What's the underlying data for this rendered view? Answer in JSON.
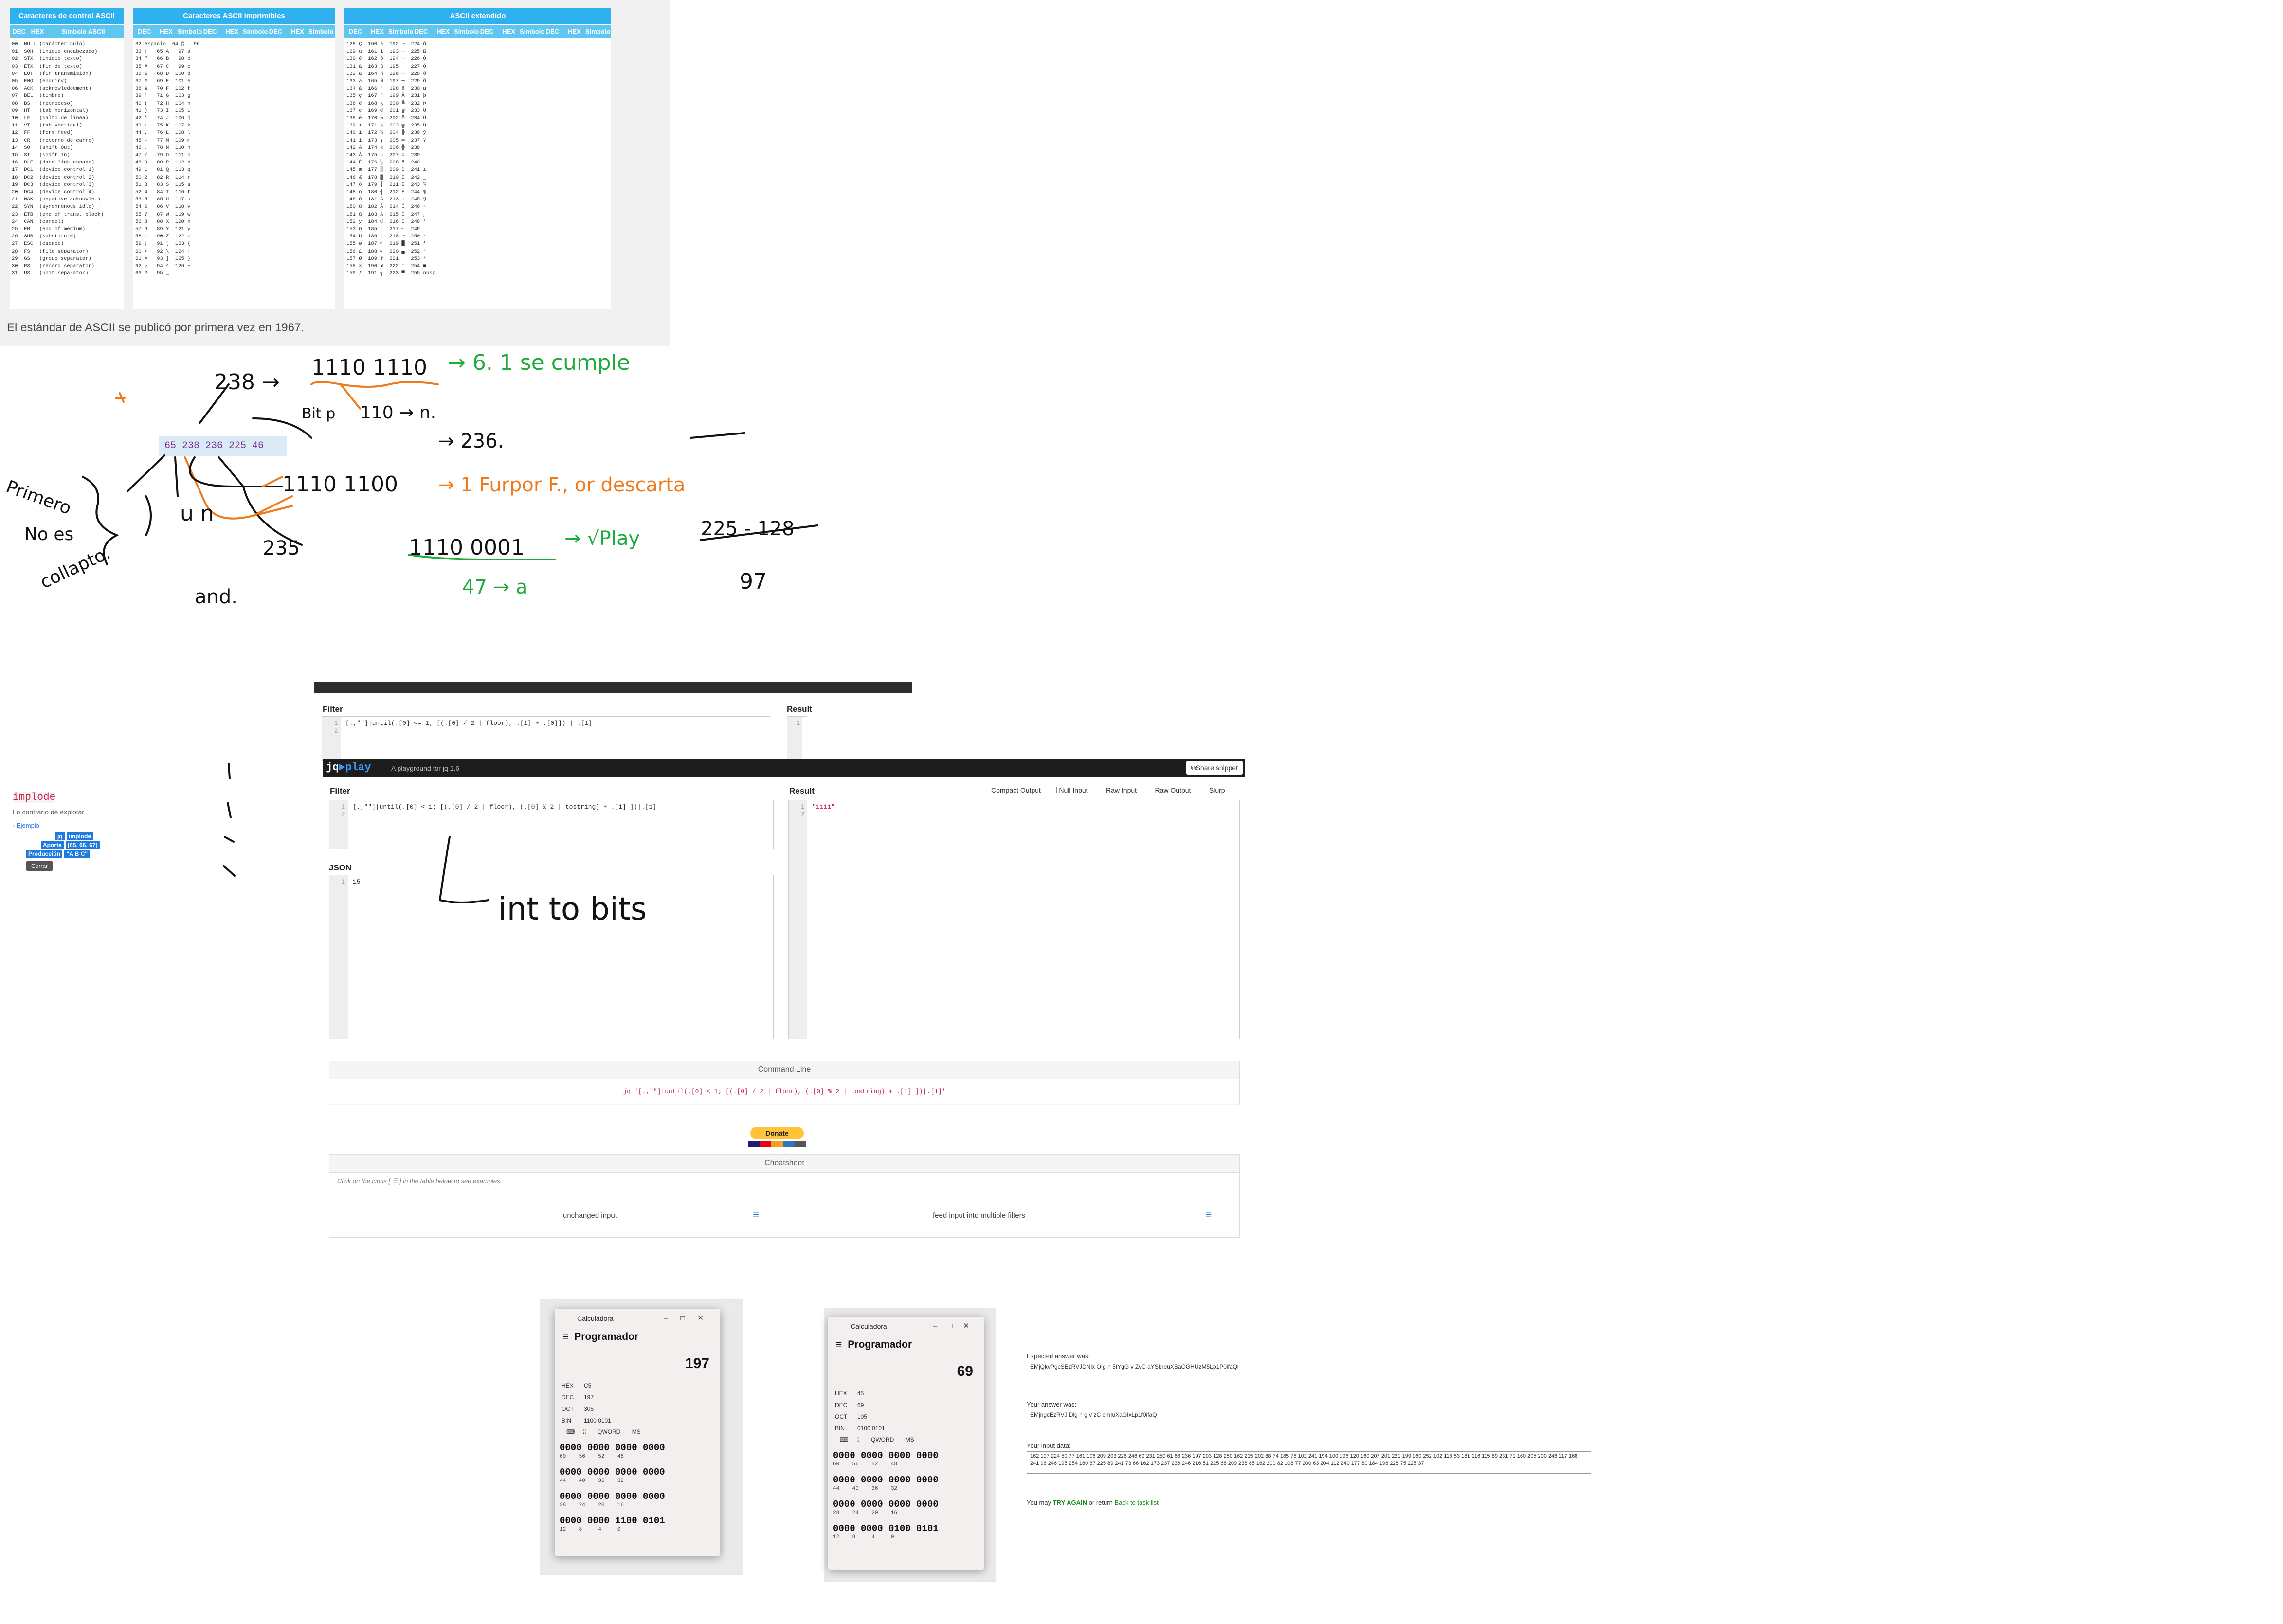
{
  "ascii_table": {
    "panels": [
      {
        "title": "Caracteres de control ASCII",
        "headers": [
          "DEC",
          "HEX",
          "Símbolo ASCII"
        ]
      },
      {
        "title": "Caracteres ASCII imprimibles",
        "headers": [
          "DEC",
          "HEX",
          "Símbolo",
          "DEC",
          "HEX",
          "Símbolo",
          "DEC",
          "HEX",
          "Símbolo"
        ]
      },
      {
        "title": "ASCII extendido",
        "headers": [
          "DEC",
          "HEX",
          "Símbolo",
          "DEC",
          "HEX",
          "Símbolo",
          "DEC",
          "HEX",
          "Símbolo",
          "DEC",
          "HEX",
          "Símbolo"
        ]
      }
    ],
    "control_rows": [
      "00  NULL (carácter nulo)",
      "01  SOH  (inicio encabezado)",
      "02  STX  (inicio texto)",
      "03  ETX  (fin de texto)",
      "04  EOT  (fin transmisión)",
      "05  ENQ  (enquiry)",
      "06  ACK  (acknowledgement)",
      "07  BEL  (timbre)",
      "08  BS   (retroceso)",
      "09  HT   (tab horizontal)",
      "10  LF   (salto de línea)",
      "11  VT   (tab vertical)",
      "12  FF   (form feed)",
      "13  CR   (retorno de carro)",
      "14  SO   (shift Out)",
      "15  SI   (shift In)",
      "16  DLE  (data link escape)",
      "17  DC1  (device control 1)",
      "18  DC2  (device control 2)",
      "19  DC3  (device control 3)",
      "20  DC4  (device control 4)",
      "21  NAK  (negative acknowle.)",
      "22  SYN  (synchronous idle)",
      "23  ETB  (end of trans. block)",
      "24  CAN  (cancel)",
      "25  EM   (end of medium)",
      "26  SUB  (substitute)",
      "27  ESC  (escape)",
      "28  FS   (file separator)",
      "29  GS   (group separator)",
      "30  RS   (record separator)",
      "31  US   (unit separator)"
    ],
    "printable_rows": [
      "32 espacio  64 @   96 `",
      "33 !   65 A   97 a",
      "34 \"   66 B   98 b",
      "35 #   67 C   99 c",
      "36 $   68 D  100 d",
      "37 %   69 E  101 e",
      "38 &   70 F  102 f",
      "39 '   71 G  103 g",
      "40 (   72 H  104 h",
      "41 )   73 I  105 i",
      "42 *   74 J  106 j",
      "43 +   75 K  107 k",
      "44 ,   76 L  108 l",
      "45 -   77 M  109 m",
      "46 .   78 N  110 n",
      "47 /   79 O  111 o",
      "48 0   80 P  112 p",
      "49 1   81 Q  113 q",
      "50 2   82 R  114 r",
      "51 3   83 S  115 s",
      "52 4   84 T  116 t",
      "53 5   85 U  117 u",
      "54 6   86 V  118 v",
      "55 7   87 W  119 w",
      "56 8   88 X  120 x",
      "57 9   89 Y  121 y",
      "58 :   90 Z  122 z",
      "59 ;   91 [  123 {",
      "60 <   92 \\  124 |",
      "61 =   93 ]  125 }",
      "62 >   94 ^  126 ~",
      "63 ?   95 _"
    ],
    "extended_rows": [
      "128 Ç  160 á  192 └  224 Ó",
      "129 ü  161 í  193 ┴  225 ß",
      "130 é  162 ó  194 ┬  226 Ô",
      "131 â  163 ú  195 ├  227 Ò",
      "132 ä  164 ñ  196 ─  228 õ",
      "133 à  165 Ñ  197 ┼  229 Õ",
      "134 å  166 ª  198 ã  230 µ",
      "135 ç  167 º  199 Ã  231 þ",
      "136 ê  168 ¿  200 ╚  232 Þ",
      "137 ë  169 ®  201 ╔  233 Ú",
      "138 è  170 ¬  202 ╩  234 Û",
      "139 ï  171 ½  203 ╦  235 Ù",
      "140 î  172 ¼  204 ╠  236 ý",
      "141 ì  173 ¡  205 ═  237 Ý",
      "142 Ä  174 «  206 ╬  238 ¯",
      "143 Å  175 »  207 ¤  239 ´",
      "144 É  176 ░  208 ð  240 ­",
      "145 æ  177 ▒  209 Ð  241 ±",
      "146 Æ  178 ▓  210 Ê  242 ‗",
      "147 ô  179 │  211 Ë  243 ¾",
      "148 ö  180 ┤  212 È  244 ¶",
      "149 ò  181 Á  213 ı  245 §",
      "150 û  182 Â  214 Í  246 ÷",
      "151 ù  183 À  215 Î  247 ¸",
      "152 ÿ  184 ©  216 Ï  248 °",
      "153 Ö  185 ╣  217 ┘  249 ¨",
      "154 Ü  186 ║  218 ┌  250 ·",
      "155 ø  187 ╗  219 █  251 ¹",
      "156 £  188 ╝  220 ▄  252 ³",
      "157 Ø  189 ¢  221 ¦  253 ²",
      "158 ×  190 ¥  222 Ì  254 ■",
      "159 ƒ  191 ┐  223 ▀  255 nbsp"
    ],
    "caption": "El estándar de ASCII se publicó por primera vez en 1967."
  },
  "handwriting": {
    "bytes": "65 238 236 225 46",
    "n238": "238 →",
    "bits_238": "1110  1110",
    "check_6_1": "→ 6. 1 se cumple",
    "bit_p": "Bit p",
    "n110": "110 → n.",
    "n236": "→ 236.",
    "bits_236": "1110 1100",
    "furpor": "→ 1 Furpor F., or descarta",
    "primero": "Primero",
    "no_es": "No es",
    "colapto": "collapto.",
    "u_n": "u  n",
    "n235": "235",
    "bits_225": "1110  0001",
    "vplay": "→ √Play",
    "calc_225": "225 - 128",
    "r97": "97",
    "a47": "47 → a",
    "and": "and.",
    "int_to_bits": "int to bits"
  },
  "jqplay_back": {
    "filter_label": "Filter",
    "result_label": "Result",
    "filter_code": "[.,\"\"]|until(.[0] <= 1; [(.[0] / 2 | floor), .[1] + .[0]]) | .[1]",
    "result_code": "\"",
    "line1": "1",
    "line2": "2"
  },
  "jqplay_front": {
    "logo_jq": "jq",
    "logo_play": "►play",
    "subtitle": "A playground for jq 1.6",
    "share_button": "Share snippet",
    "filter_label": "Filter",
    "result_label": "Result",
    "options": [
      "Compact Output",
      "Null Input",
      "Raw Input",
      "Raw Output",
      "Slurp"
    ],
    "filter_code": "[.,\"\"]|until(.[0] < 1; [(.[0] / 2 | floor), (.[0] % 2 | tostring) + .[1] ])|.[1]",
    "result_code": "\"1111\"",
    "json_label": "JSON",
    "json_input": "15",
    "command_line_label": "Command Line",
    "command_line": "jq '[.,\"\"]|until(.[0] < 1; [(.[0] / 2 | floor), (.[0] % 2 | tostring) + .[1] ])|.[1]'",
    "donate_label": "Donate",
    "cheatsheet_label": "Cheatsheet",
    "cheatsheet_hint": "Click on the icons [ ☰ ] in the table below to see examples.",
    "cheatsheet_items": [
      "unchanged input",
      "feed input into multiple filters"
    ],
    "gutter": [
      "1",
      "2"
    ]
  },
  "implode_doc": {
    "name": "implode",
    "description": "Lo contrario de explotar.",
    "example_label": "Ejemplo",
    "jq_label": "jq",
    "jq_code": "implode",
    "input_label": "Aporte",
    "input_value": "[65, 66, 67]",
    "output_label": "Producción",
    "output_value": "\"A B C\"",
    "close_label": "Cerrar"
  },
  "calculator_1": {
    "title": "Calculadora",
    "mode": "Programador",
    "value": "197",
    "hex_label": "HEX",
    "hex": "C5",
    "dec_label": "DEC",
    "dec": "197",
    "oct_label": "OCT",
    "oct": "305",
    "bin_label": "BIN",
    "bin": "1100 0101",
    "word_label": "QWORD",
    "ms_label": "MS",
    "bits": [
      "0000 0000 0000 0000",
      "0000 0000 0000 0000",
      "0000 0000 0000 0000",
      "0000 0000 1100 0101"
    ],
    "bit_positions": [
      "60    56    52    48",
      "44    40    36    32",
      "28    24    20    16",
      "12    8     4     0"
    ]
  },
  "calculator_2": {
    "title": "Calculadora",
    "mode": "Programador",
    "value": "69",
    "hex_label": "HEX",
    "hex": "45",
    "dec_label": "DEC",
    "dec": "69",
    "oct_label": "OCT",
    "oct": "105",
    "bin_label": "BIN",
    "bin": "0100 0101",
    "word_label": "QWORD",
    "ms_label": "MS",
    "bits": [
      "0000 0000 0000 0000",
      "0000 0000 0000 0000",
      "0000 0000 0000 0000",
      "0000 0000 0100 0101"
    ],
    "bit_positions": [
      "60    56    52    48",
      "44    40    36    32",
      "28    24    20    16",
      "12    8     4     0"
    ]
  },
  "answer_check": {
    "expected_label": "Expected answer was:",
    "expected_value": "EMjQkvPgcSEzRVJDNlx OIg n 5tYgG v ZvC aYSbreuXSaOGHUzM5Lp1P0ifaQi",
    "yours_label": "Your answer was:",
    "yours_value": "EMjngcEzRVJ Dlg h g v zC emIuXaGIxLp1f0ifaQ",
    "input_label": "Your input data:",
    "input_value": "162 197 224 50 77 161 106 209 203 226 246 69 231 250 61 66 236 197 203 128 250 162 215 202 88 74 185 78 102 241 194 100 196 120 160 207 201 231 199 160 252 102 118 53 181 116 115 89 231 71 160 205 200 246 117 168 241 96 246 195 254 160 67 225 89 241 73 66 162 173 237 236 246 216 51 225 68 209 238 85 162 200 82 108 77 200 63 204 112 240 177 80 184 196 228 75 225 37",
    "try_again_prefix": "You may",
    "try_again": "TRY AGAIN",
    "or_return": "or return",
    "back_link": "Back to task list"
  },
  "colors": {
    "ascii_header": "#2fb0ef",
    "ascii_subheader": "#5fc6f2",
    "ink_green": "#1faa3c",
    "ink_orange": "#f07a1a",
    "ink_black": "#111111",
    "jq_blue": "#3b99fc"
  }
}
